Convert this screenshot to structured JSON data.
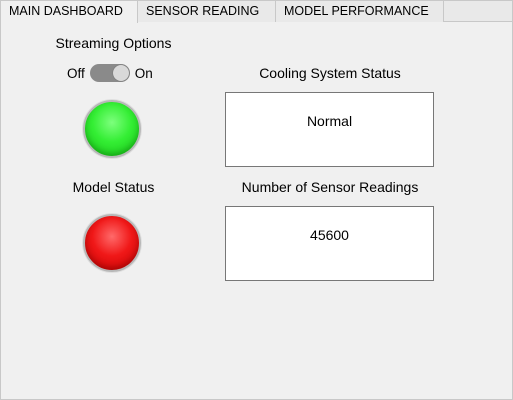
{
  "tabs": [
    {
      "label": "MAIN DASHBOARD",
      "active": true
    },
    {
      "label": "SENSOR READING",
      "active": false
    },
    {
      "label": "MODEL PERFORMANCE",
      "active": false
    }
  ],
  "streaming": {
    "title": "Streaming Options",
    "off_label": "Off",
    "on_label": "On",
    "state": "on",
    "lamp_color": "#22dd22"
  },
  "model_status": {
    "title": "Model Status",
    "lamp_color": "#ee1111"
  },
  "cooling": {
    "title": "Cooling System Status",
    "value": "Normal"
  },
  "sensor_count": {
    "title": "Number of Sensor Readings",
    "value": "45600"
  }
}
